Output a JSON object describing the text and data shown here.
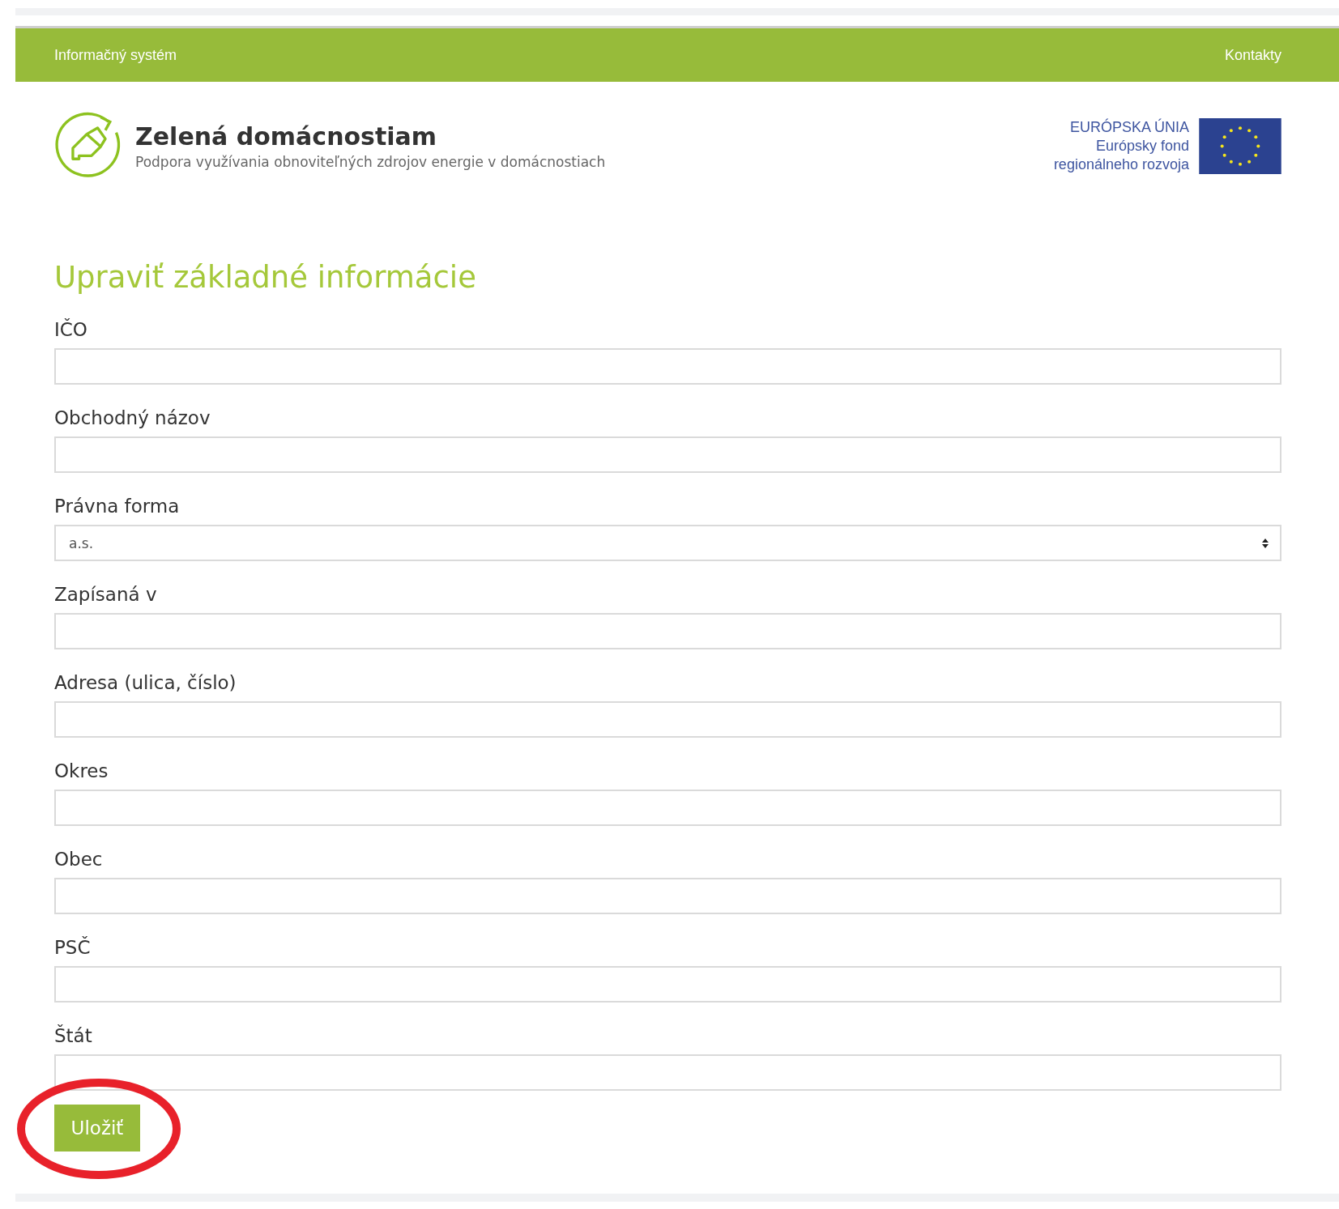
{
  "top_bar": {
    "left_link": "Informačný systém",
    "right_link": "Kontakty"
  },
  "brand": {
    "title": "Zelená domácnostiam",
    "subtitle": "Podpora využívania obnoviteľných zdrojov energie v domácnostiach"
  },
  "eu_logo": {
    "lines": [
      "EURÓPSKA ÚNIA",
      "Európsky fond",
      "regionálneho rozvoja"
    ]
  },
  "heading": "Upraviť základné informácie",
  "fields": [
    {
      "kind": "text",
      "label": "IČO"
    },
    {
      "kind": "text",
      "label": "Obchodný názov"
    },
    {
      "kind": "select",
      "label": "Právna forma",
      "value": "a.s."
    },
    {
      "kind": "text",
      "label": "Zapísaná v"
    },
    {
      "kind": "text",
      "label": "Adresa (ulica, číslo)"
    },
    {
      "kind": "text",
      "label": "Okres"
    },
    {
      "kind": "text",
      "label": "Obec"
    },
    {
      "kind": "text",
      "label": "PSČ"
    },
    {
      "kind": "text",
      "label": "Štát"
    }
  ],
  "save_button": "Uložiť"
}
